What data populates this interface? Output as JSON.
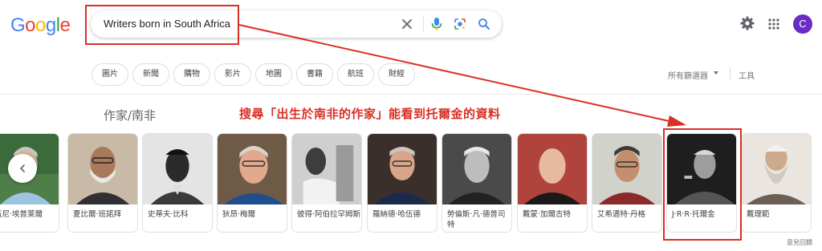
{
  "logo": "Google",
  "logo_colors": [
    "#4285F4",
    "#EA4335",
    "#FBBC05",
    "#4285F4",
    "#34A853",
    "#EA4335"
  ],
  "search": {
    "query": "Writers born in South Africa"
  },
  "icons": {
    "clear": "close-icon",
    "voice": "microphone-icon",
    "lens": "camera-lens-icon",
    "search": "search-icon",
    "settings": "gear-icon",
    "apps": "apps-grid-icon"
  },
  "account": {
    "initial": "C",
    "color": "#6a2cc4"
  },
  "chips": [
    "圖片",
    "新聞",
    "購物",
    "影片",
    "地圖",
    "書籍",
    "航班",
    "財經"
  ],
  "filters": {
    "all_filters": "所有篩選器",
    "tools": "工具"
  },
  "carousel": {
    "title": "作家/南非",
    "people": [
      {
        "name": "伍尼·埃普萊爾"
      },
      {
        "name": "夏比爾·班諾拜"
      },
      {
        "name": "史蒂夫·比科"
      },
      {
        "name": "狄昂·梅爾"
      },
      {
        "name": "彼得·阿伯拉罕姆斯"
      },
      {
        "name": "羅納德·哈伍德"
      },
      {
        "name": "勞倫斯·凡·德普司特"
      },
      {
        "name": "戴蒙·加爾古特"
      },
      {
        "name": "艾希邁特·丹格"
      },
      {
        "name": "J·R·R·托爾金"
      },
      {
        "name": "戴理範"
      }
    ]
  },
  "annotation": "搜尋「出生於南非的作家」能看到托爾金的資料",
  "feedback": "意見回饋",
  "accent_color": "#d93025"
}
